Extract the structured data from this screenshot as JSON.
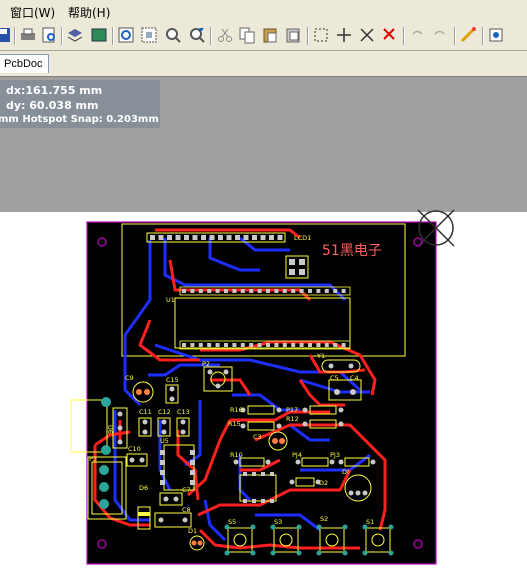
{
  "menu": {
    "window": "窗口(W)",
    "help": "帮助(H)"
  },
  "tabs": {
    "active": "PcbDoc"
  },
  "hud": {
    "dx": "dx:161.755 mm",
    "dy": "dy: 60.038  mm",
    "snap": "mm Hotspot Snap: 0.203mm"
  },
  "pcb": {
    "brand_text": "51黑电子",
    "component_labels": {
      "lcd": "LCD1",
      "u1": "U1",
      "y1": "Y1",
      "p2": "P2",
      "c9": "C9",
      "c15": "C15",
      "c11": "C11",
      "c12": "C12",
      "c13": "C13",
      "u6": "U6",
      "c10": "C10",
      "u5": "U5",
      "p3": "P3",
      "d6": "D6",
      "c7": "C7",
      "c8": "C8",
      "d1": "D1",
      "c5": "C5",
      "c4": "C4",
      "r16": "R16",
      "p17": "P17",
      "r12": "R12",
      "r15": "R15",
      "r10": "R10",
      "pj4": "PJ4",
      "pj3": "PJ3",
      "c3": "C3",
      "d2": "D2",
      "di": "DI",
      "s5": "S5",
      "s3": "S3",
      "s2": "S2",
      "s1": "S1"
    }
  },
  "colors": {
    "board": "#000000",
    "top_copper": "#ff2020",
    "bottom_copper": "#1e2eff",
    "silkscreen": "#ffff40",
    "keepout": "#c000c0",
    "pad": "#c8c8c8"
  }
}
